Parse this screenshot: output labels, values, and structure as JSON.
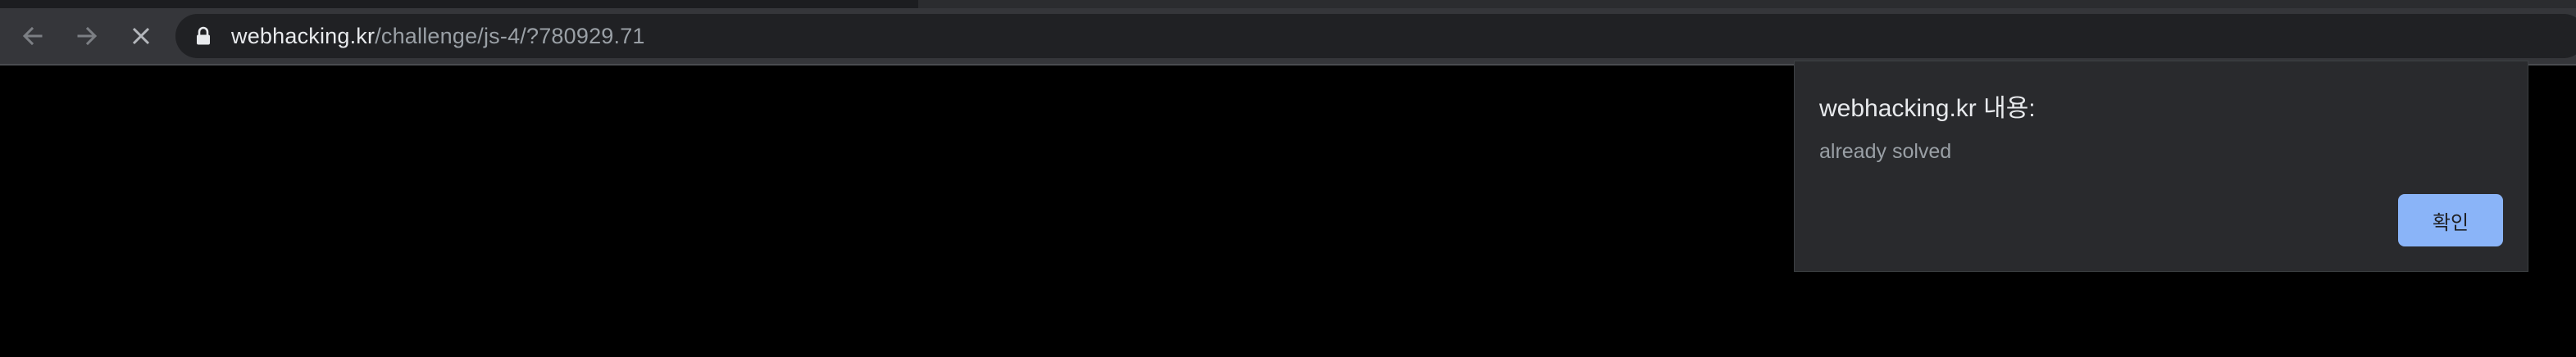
{
  "browser": {
    "nav": {
      "back_icon": "arrow-left-icon",
      "forward_icon": "arrow-right-icon",
      "stop_icon": "close-icon"
    },
    "address_bar": {
      "lock_icon": "lock-icon",
      "host": "webhacking.kr",
      "path": "/challenge/js-4/?780929.71"
    }
  },
  "dialog": {
    "title": "webhacking.kr 내용:",
    "message": "already solved",
    "ok_label": "확인"
  },
  "colors": {
    "toolbar_bg": "#35363a",
    "omnibox_bg": "#202124",
    "dialog_bg": "#292a2d",
    "button_accent": "#8ab4f8",
    "page_bg": "#000000"
  }
}
